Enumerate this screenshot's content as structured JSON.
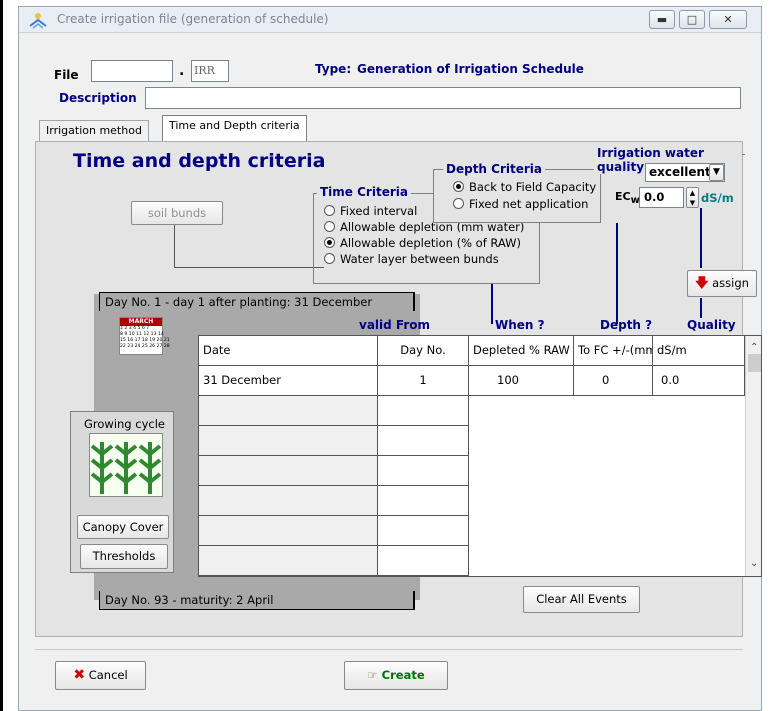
{
  "window": {
    "title": "Create irrigation file (generation of schedule)"
  },
  "file": {
    "label": "File",
    "value": "",
    "extension": "IRR",
    "type_label": "Type:",
    "type_value": "Generation of Irrigation Schedule"
  },
  "description": {
    "label": "Description",
    "value": ""
  },
  "tabs": [
    {
      "label": "Irrigation method"
    },
    {
      "label": "Time and Depth criteria"
    }
  ],
  "panel": {
    "heading": "Time and depth criteria",
    "soil_bunds": "soil bunds",
    "time_criteria": {
      "title": "Time Criteria",
      "options": [
        "Fixed interval",
        "Allowable depletion (mm water)",
        "Allowable depletion (% of RAW)",
        "Water layer between bunds"
      ],
      "selected_index": 2
    },
    "depth_criteria": {
      "title": "Depth Criteria",
      "options": [
        "Back to Field Capacity",
        "Fixed net application"
      ],
      "selected_index": 0
    },
    "water_quality": {
      "title": "Irrigation water quality",
      "selected": "excellent",
      "ec_label": "EC",
      "ec_sub": "w",
      "ec_value": "0.0",
      "unit": "dS/m"
    },
    "assign": "assign",
    "day_start": "Day No. 1 - day 1 after planting: 31 December",
    "day_end": "Day No. 93 - maturity: 2 April",
    "calendar": {
      "month": "MARCH",
      "rows": [
        "1 2 3 4 5 6 7",
        "8 9 10 11 12 13 14",
        "15 16 17 18 19 20 21",
        "22 23 24 25 26 27 28"
      ]
    },
    "growing_cycle": "Growing cycle",
    "canopy_cover": "Canopy Cover",
    "thresholds": "Thresholds",
    "column_labels": {
      "valid_from": "valid From",
      "when": "When ?",
      "depth": "Depth ?",
      "quality": "Quality"
    },
    "table": {
      "headers": [
        "Date",
        "Day No.",
        "Depleted % RAW",
        "To FC +/-(mm)",
        "dS/m"
      ],
      "rows": [
        [
          "31 December",
          "1",
          "100",
          "0",
          "0.0"
        ]
      ]
    },
    "clear_all": "Clear All Events"
  },
  "footer": {
    "cancel": "Cancel",
    "create": "Create"
  }
}
